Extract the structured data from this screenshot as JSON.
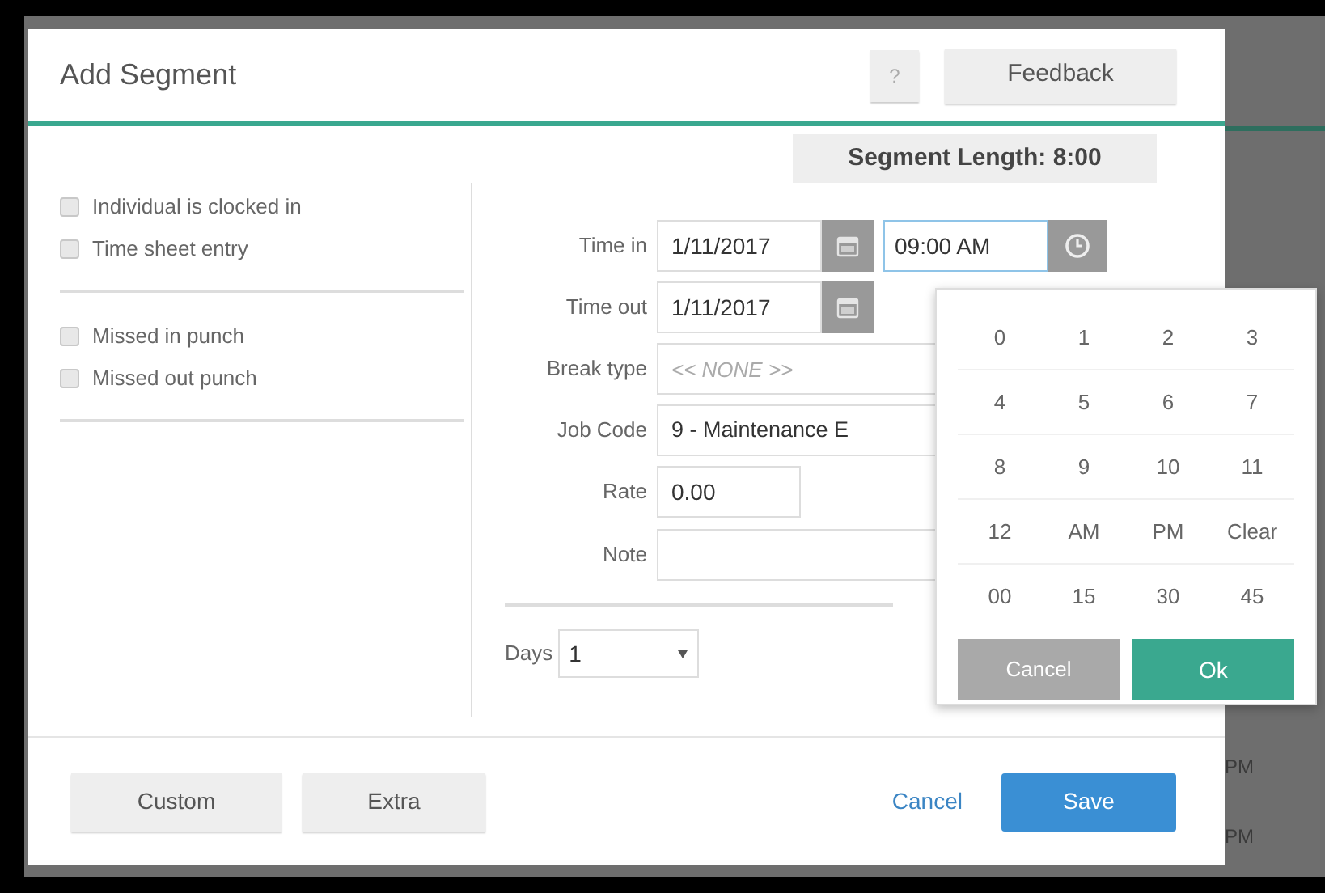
{
  "dialog": {
    "title": "Add Segment",
    "help_button": "?",
    "feedback_button": "Feedback",
    "segment_length": "Segment Length: 8:00",
    "option_groups": [
      {
        "options": [
          {
            "label": "Individual is clocked in",
            "checked": false
          },
          {
            "label": "Time sheet entry",
            "checked": false
          }
        ]
      },
      {
        "options": [
          {
            "label": "Missed in punch",
            "checked": false
          },
          {
            "label": "Missed out punch",
            "checked": false
          }
        ]
      }
    ],
    "form": {
      "time_in": {
        "label": "Time in",
        "date": "1/11/2017",
        "time": "09:00 AM"
      },
      "time_out": {
        "label": "Time out",
        "date": "1/11/2017"
      },
      "break_type": {
        "label": "Break type",
        "placeholder": "<< NONE >>"
      },
      "job_code": {
        "label": "Job Code",
        "value": "9 - Maintenance E"
      },
      "rate": {
        "label": "Rate",
        "value": "0.00"
      },
      "note": {
        "label": "Note"
      },
      "days": {
        "label": "Days",
        "value": "1"
      }
    },
    "time_picker": {
      "rows": [
        {
          "keys": [
            "0",
            "1",
            "2",
            "3"
          ]
        },
        {
          "keys": [
            "4",
            "5",
            "6",
            "7"
          ]
        },
        {
          "keys": [
            "8",
            "9",
            "10",
            "11"
          ]
        },
        {
          "keys": [
            "12",
            "AM",
            "PM",
            "Clear"
          ]
        },
        {
          "keys": [
            "00",
            "15",
            "30",
            "45"
          ]
        }
      ],
      "cancel": {
        "label": "Cancel",
        "disabled": true
      },
      "ok": "Ok"
    },
    "footer": {
      "buttons": [
        "Custom",
        "Extra"
      ],
      "cancel": "Cancel",
      "save": "Save"
    }
  },
  "background": {
    "cells": [
      "PM",
      "PM"
    ]
  }
}
